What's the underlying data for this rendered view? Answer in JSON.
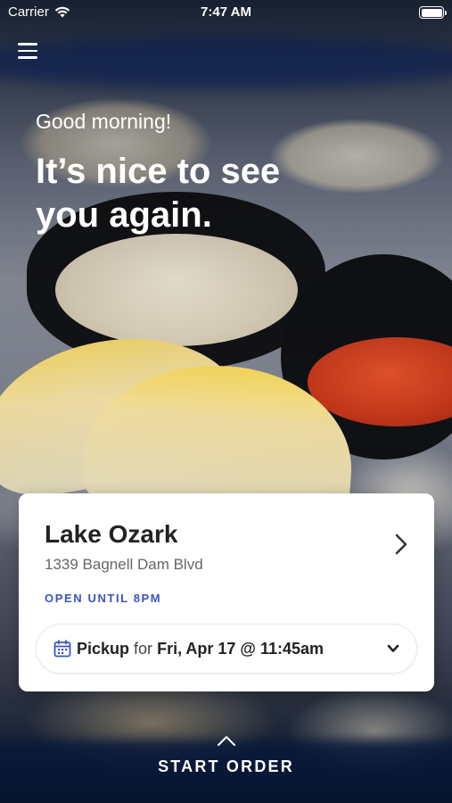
{
  "status_bar": {
    "carrier": "Carrier",
    "time": "7:47 AM",
    "wifi_icon": "wifi-icon",
    "battery_icon": "battery-icon"
  },
  "header": {
    "menu_icon": "hamburger-menu-icon"
  },
  "greeting": {
    "salutation": "Good morning!",
    "headline": "It’s nice to see you again."
  },
  "location_card": {
    "name": "Lake Ozark",
    "address": "1339 Bagnell Dam Blvd",
    "hours_status": "OPEN UNTIL 8PM",
    "chevron_icon": "chevron-right-icon",
    "accent_color": "#3b55c4"
  },
  "order_selector": {
    "calendar_icon": "calendar-icon",
    "mode": "Pickup",
    "connector": "for",
    "datetime": "Fri, Apr 17 @ 11:45am",
    "dropdown_icon": "chevron-down-icon"
  },
  "footer": {
    "chevron_icon": "chevron-up-icon",
    "cta": "START ORDER"
  }
}
